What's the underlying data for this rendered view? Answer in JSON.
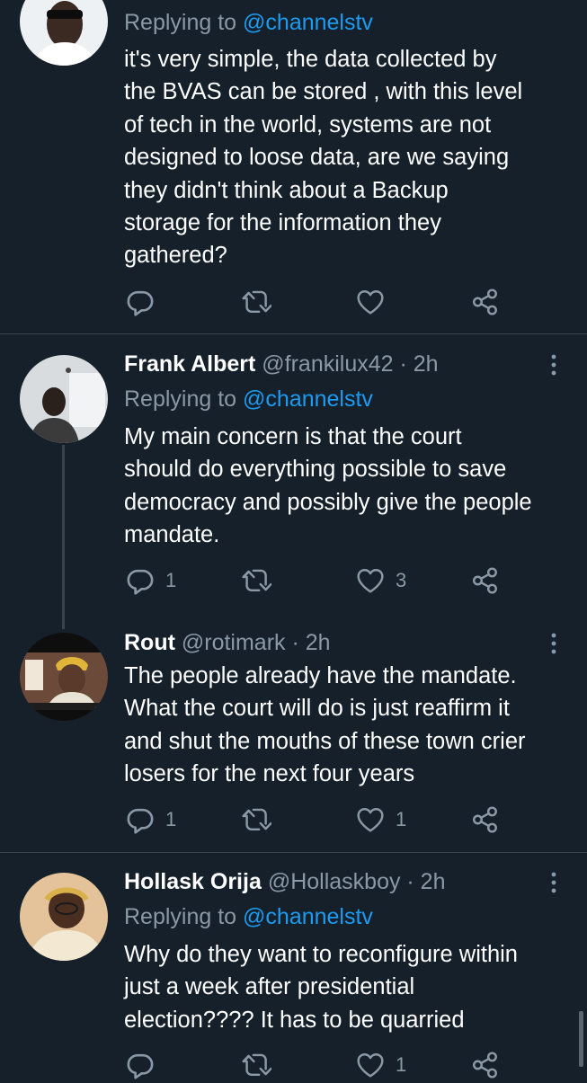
{
  "tweets": [
    {
      "replying_prefix": "Replying to ",
      "replying_to": "@channelstv",
      "text": [
        "it's very simple, the data collected by",
        "the BVAS can be stored , with this level",
        "of tech in the world, systems are not",
        "designed to loose data, are we saying",
        "they didn't think about a Backup",
        "storage for the information they",
        "gathered?"
      ],
      "replies": "",
      "retweets": "",
      "likes": ""
    },
    {
      "name": "Frank Albert",
      "handle": "@frankilux42",
      "time": " · 2h",
      "replying_prefix": "Replying to ",
      "replying_to": "@channelstv",
      "text": [
        "My main concern is that the court",
        "should do everything possible to save",
        "democracy and possibly give the people",
        "mandate."
      ],
      "replies": "1",
      "retweets": "",
      "likes": "3"
    },
    {
      "name": "Rout",
      "handle": "@rotimark",
      "time": " · 2h",
      "text": [
        "The people already have the mandate.",
        "What the court will do is just reaffirm it",
        "and shut the mouths of these town crier",
        "losers for the next four years"
      ],
      "replies": "1",
      "retweets": "",
      "likes": "1"
    },
    {
      "name": "Hollask Orija",
      "handle": "@Hollaskboy",
      "time": " · 2h",
      "replying_prefix": "Replying to ",
      "replying_to": "@channelstv",
      "text": [
        "Why do they want to reconfigure within",
        "just a week after presidential",
        "election???? It has to be quarried"
      ],
      "replies": "",
      "retweets": "",
      "likes": "1"
    }
  ],
  "theme": {
    "background": "#15202b",
    "text": "#ffffff",
    "muted": "#8b98a5",
    "accent": "#1d9bf0",
    "divider": "#38444d"
  },
  "icons": {
    "reply": "reply-icon",
    "retweet": "retweet-icon",
    "like": "heart-icon",
    "share": "share-icon",
    "more": "more-vertical-icon"
  }
}
